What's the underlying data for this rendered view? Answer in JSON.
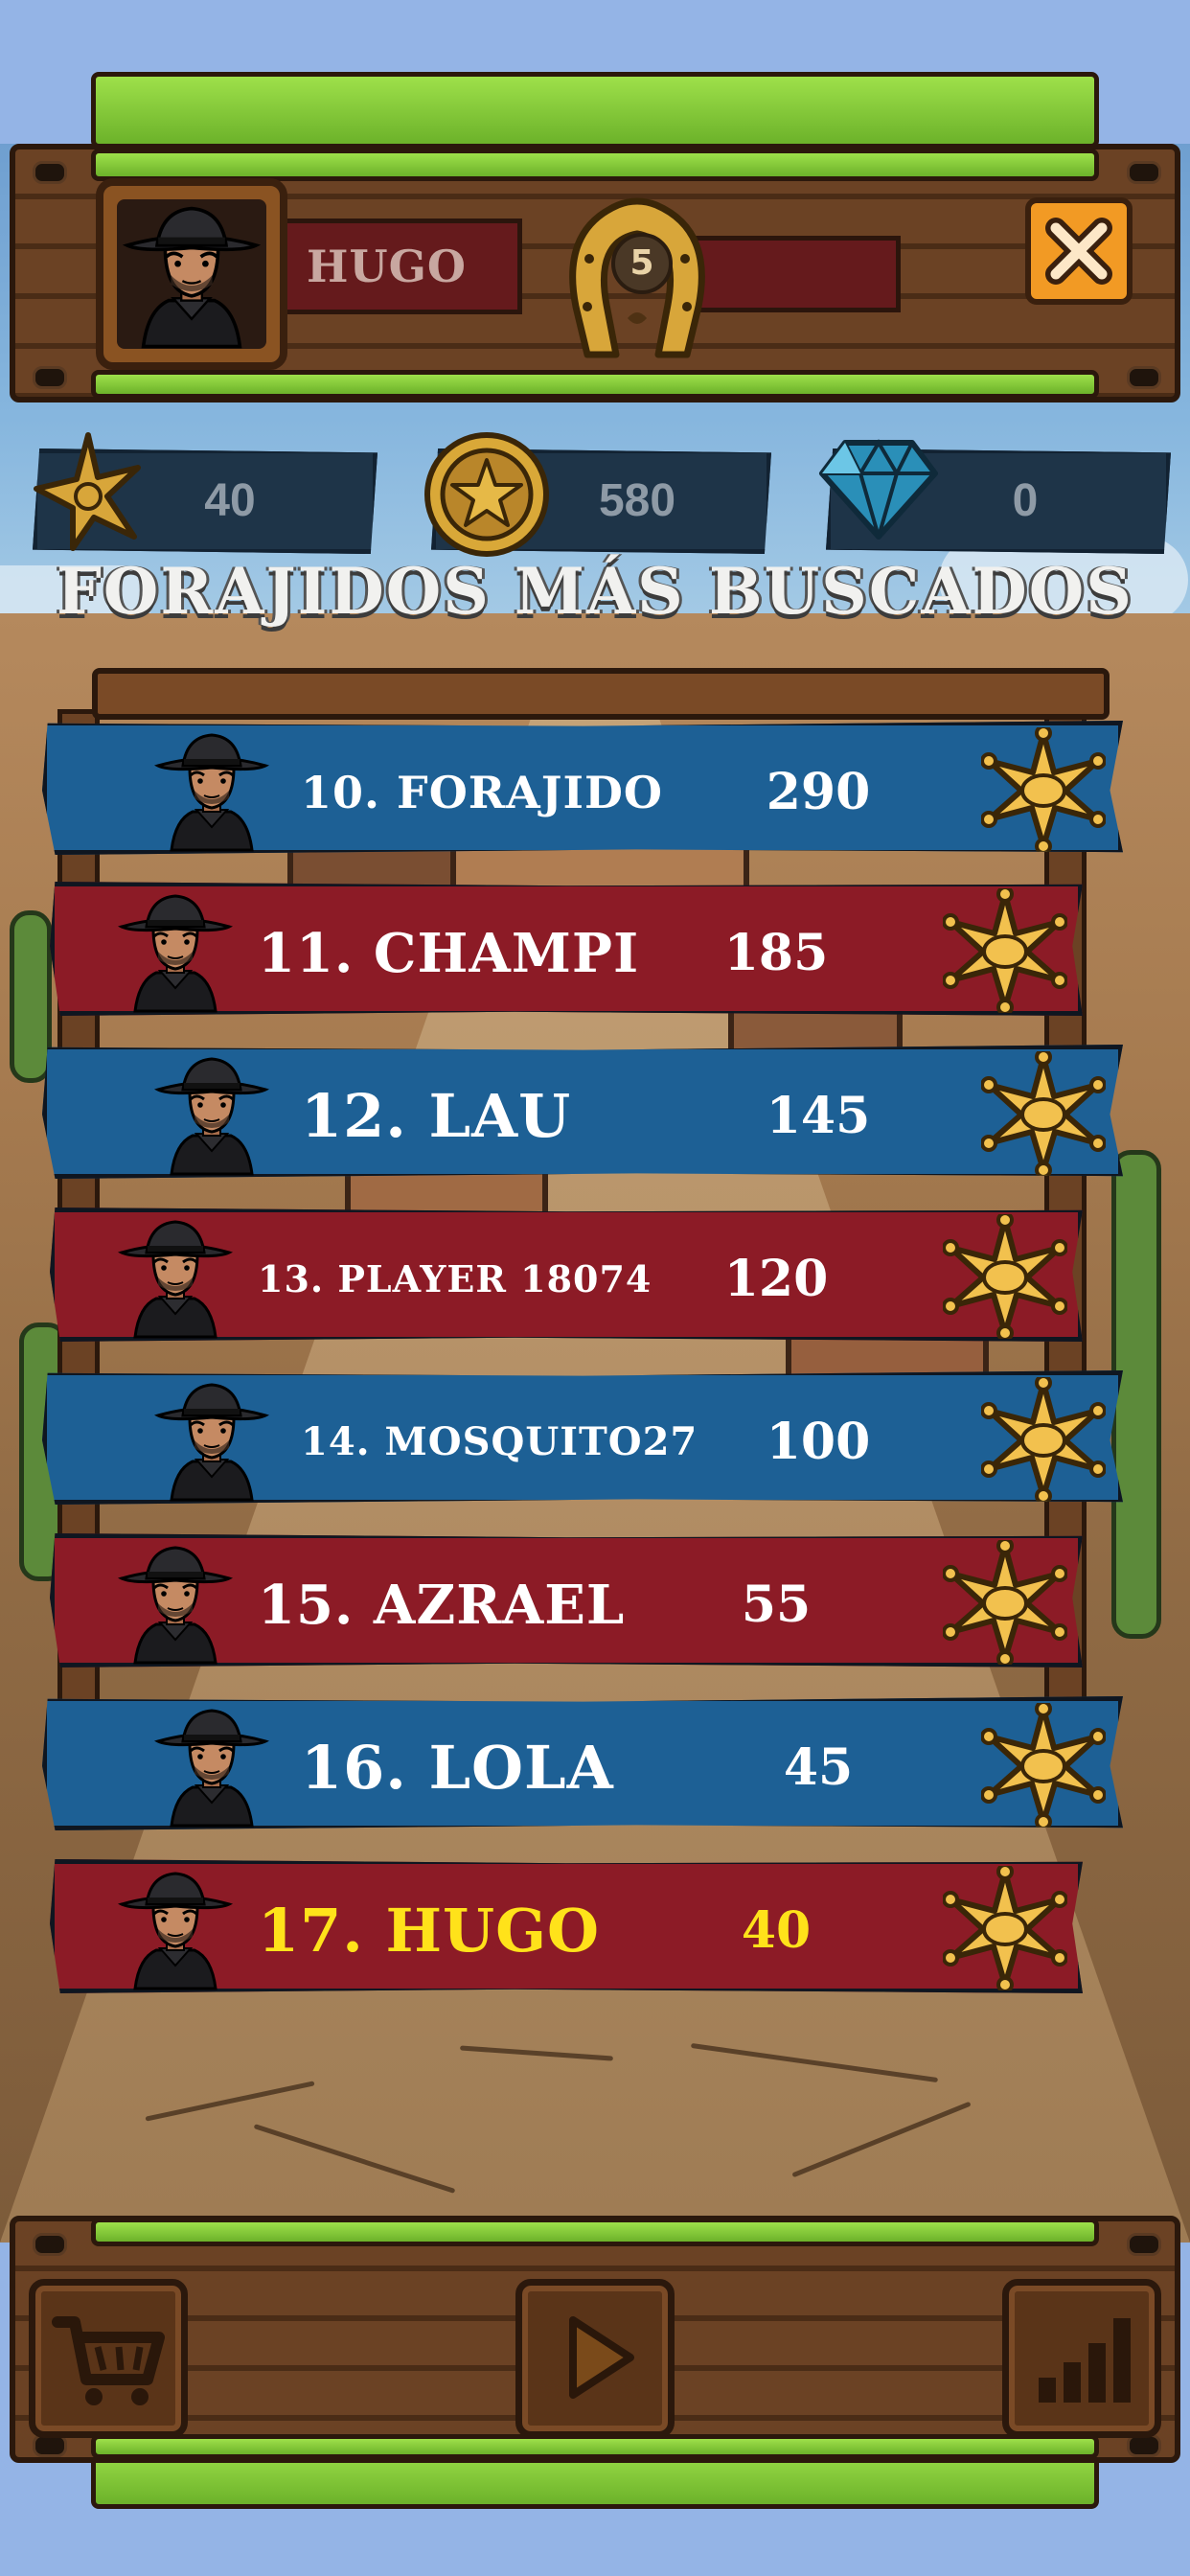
{
  "player": {
    "name": "HUGO",
    "level": "5"
  },
  "currencies": {
    "stars": "40",
    "coins": "580",
    "gems": "0"
  },
  "title": "FORAJIDOS MÁS BUSCADOS",
  "leaderboard": [
    {
      "name": "10. FORAJIDO",
      "score": "290",
      "color": "blue",
      "highlight": false
    },
    {
      "name": "11. CHAMPI",
      "score": "185",
      "color": "red",
      "highlight": false
    },
    {
      "name": "12. LAU",
      "score": "145",
      "color": "blue",
      "highlight": false
    },
    {
      "name": "13. PLAYER 18074",
      "score": "120",
      "color": "red",
      "highlight": false
    },
    {
      "name": "14. MOSQUITO27",
      "score": "100",
      "color": "blue",
      "highlight": false
    },
    {
      "name": "15. AZRAEL",
      "score": "55",
      "color": "red",
      "highlight": false
    },
    {
      "name": "16. LOLA",
      "score": "45",
      "color": "blue",
      "highlight": false
    },
    {
      "name": "17. HUGO",
      "score": "40",
      "color": "red",
      "highlight": true
    }
  ],
  "nav": {
    "shop_icon": "cart-icon",
    "play_icon": "play-icon",
    "ranking_icon": "bar-chart-icon"
  },
  "colors": {
    "row_blue": "#1d6095",
    "row_red": "#8c1b26",
    "highlight_text": "#ffe21a",
    "close_button": "#f29a24"
  }
}
